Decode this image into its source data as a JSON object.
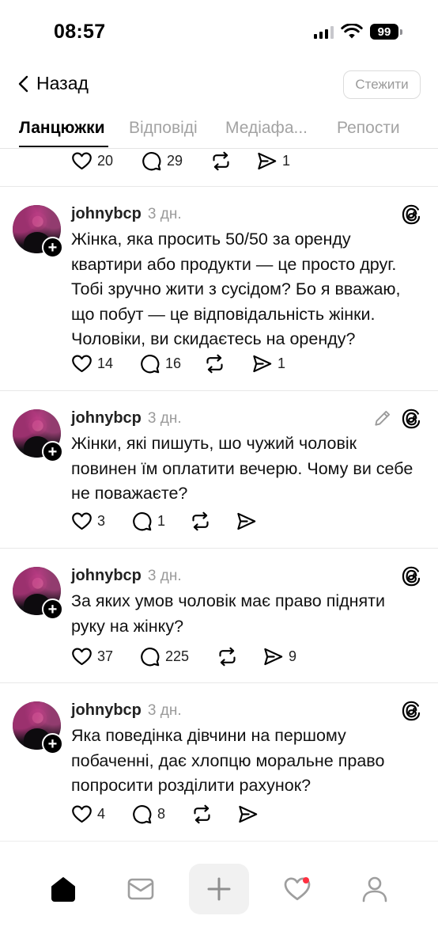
{
  "status_bar": {
    "time": "08:57",
    "battery": "99"
  },
  "header": {
    "back_label": "Назад",
    "follow_label": "Стежити"
  },
  "tabs": [
    {
      "label": "Ланцюжки",
      "active": true
    },
    {
      "label": "Відповіді",
      "active": false
    },
    {
      "label": "Медіафа...",
      "active": false
    },
    {
      "label": "Репости",
      "active": false
    }
  ],
  "feed": {
    "partial_post": {
      "likes": "20",
      "comments": "29",
      "reposts": "",
      "shares": "1"
    },
    "posts": [
      {
        "username": "johnybcp",
        "time": "3 дн.",
        "edited": false,
        "text": "Жінка, яка просить 50/50 за оренду квартири або продукти — це просто друг. Тобі зручно жити з сусідом? Бо я вважаю, що побут — це відповідальність жінки. Чоловіки, ви скидаєтесь на оренду?",
        "likes": "14",
        "comments": "16",
        "reposts": "",
        "shares": "1"
      },
      {
        "username": "johnybcp",
        "time": "3 дн.",
        "edited": true,
        "text": "Жінки, які пишуть, шо чужий чоловік повинен їм оплатити вечерю. Чому ви себе не поважаєте?",
        "likes": "3",
        "comments": "1",
        "reposts": "",
        "shares": ""
      },
      {
        "username": "johnybcp",
        "time": "3 дн.",
        "edited": false,
        "text": "За яких умов чоловік має право підняти руку на жінку?",
        "likes": "37",
        "comments": "225",
        "reposts": "",
        "shares": "9"
      },
      {
        "username": "johnybcp",
        "time": "3 дн.",
        "edited": false,
        "text": "Яка поведінка дівчини на першому побаченні, дає хлопцю моральне право попросити розділити рахунок?",
        "likes": "4",
        "comments": "8",
        "reposts": "",
        "shares": ""
      }
    ]
  },
  "bottom_nav": {
    "items": [
      "home-icon",
      "inbox-icon",
      "plus-icon",
      "heart-icon",
      "profile-icon"
    ],
    "notification_color": "#ff3040"
  }
}
